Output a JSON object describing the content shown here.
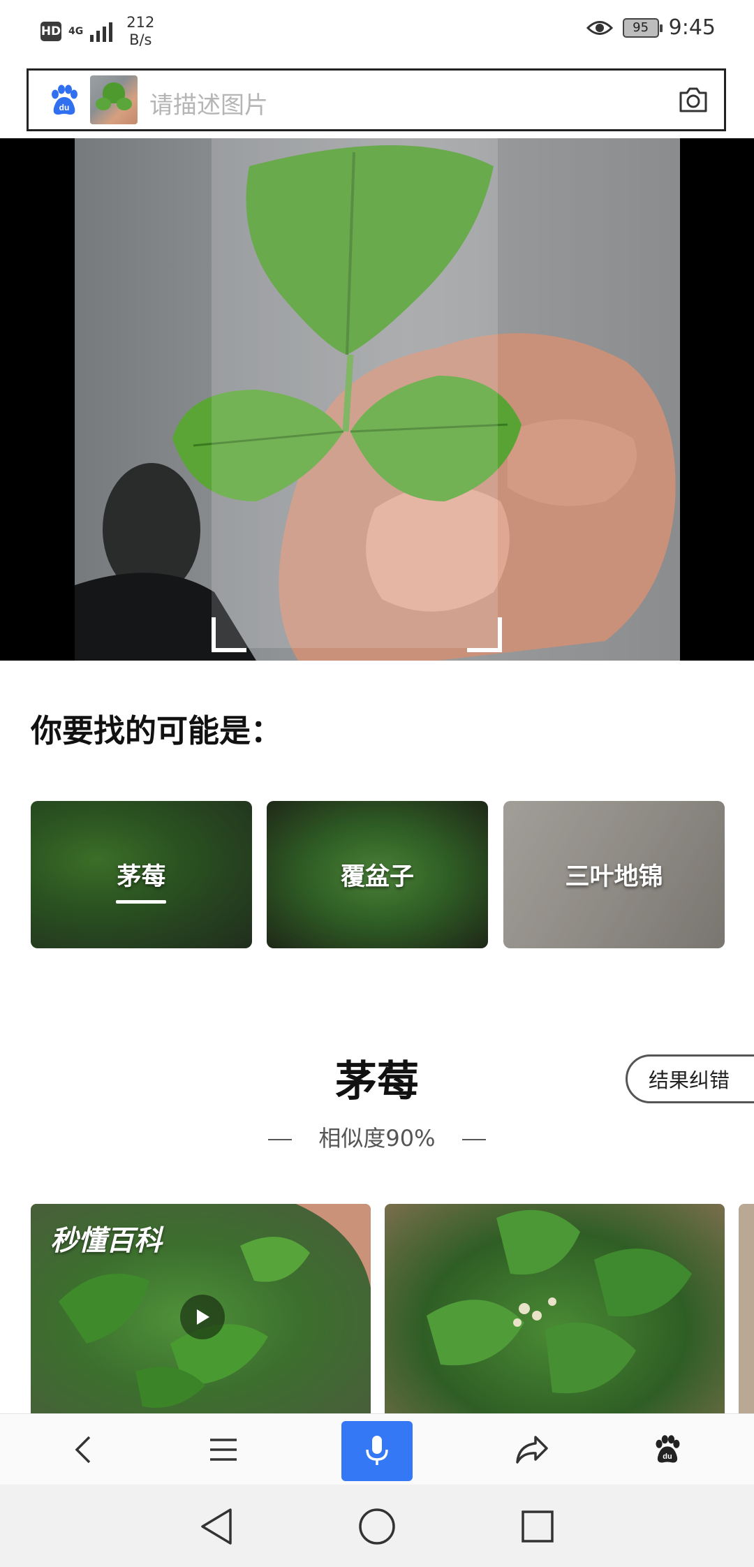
{
  "status_bar": {
    "hd": "HD",
    "network": "4G",
    "speed_value": "212",
    "speed_unit": "B/s",
    "battery": "95",
    "time": "9:45"
  },
  "search": {
    "placeholder": "请描述图片"
  },
  "section": {
    "maybe_title": "你要找的可能是："
  },
  "candidates": [
    {
      "label": "茅莓",
      "selected": true
    },
    {
      "label": "覆盆子",
      "selected": false
    },
    {
      "label": "三叶地锦",
      "selected": false
    }
  ],
  "result": {
    "title": "茅莓",
    "similarity": "相似度90%",
    "correct_button": "结果纠错",
    "video_watermark": "秒懂百科"
  },
  "toolbar": {
    "items": [
      "back-icon",
      "menu-icon",
      "mic-icon",
      "share-icon",
      "baidu-paw-icon"
    ],
    "accent": "#3478f6"
  },
  "system_nav": {
    "items": [
      "nav-back-icon",
      "nav-home-icon",
      "nav-recents-icon"
    ]
  }
}
